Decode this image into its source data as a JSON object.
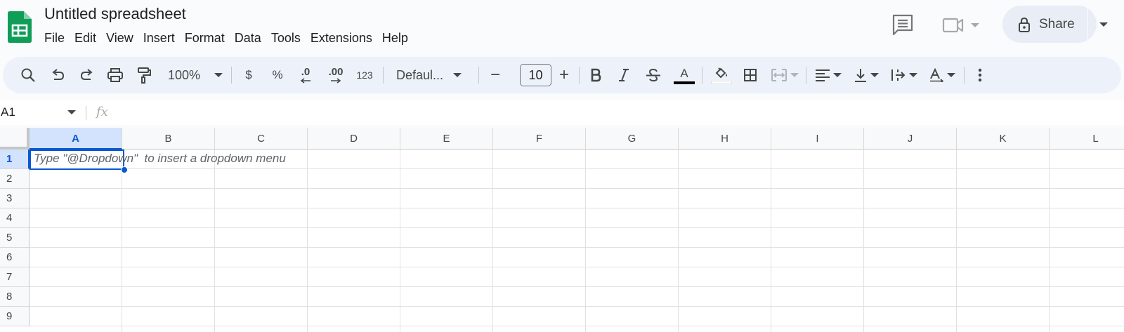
{
  "app": {
    "title": "Untitled spreadsheet",
    "brand_color": "#0f9d58"
  },
  "menubar": {
    "items": [
      "File",
      "Edit",
      "View",
      "Insert",
      "Format",
      "Data",
      "Tools",
      "Extensions",
      "Help"
    ]
  },
  "header_actions": {
    "comment_icon": "comment-icon",
    "meet_icon": "video-camera-icon",
    "share_label": "Share",
    "share_icon": "lock-icon"
  },
  "toolbar": {
    "zoom": "100%",
    "currency_label": "$",
    "percent_label": "%",
    "decrease_decimal_label": ".0",
    "increase_decimal_label": ".00",
    "more_formats_label": "123",
    "font_family": "Defaul...",
    "font_size": "10",
    "decrease_size_label": "−",
    "increase_size_label": "+",
    "text_color": "#000000",
    "fill_color": "#ffffff"
  },
  "formula_bar": {
    "name_box": "A1",
    "fx_label": "fx",
    "formula": ""
  },
  "grid": {
    "columns": [
      "A",
      "B",
      "C",
      "D",
      "E",
      "F",
      "G",
      "H",
      "I",
      "J",
      "K",
      "L"
    ],
    "rows": [
      "1",
      "2",
      "3",
      "4",
      "5",
      "6",
      "7",
      "8",
      "9"
    ],
    "selected_column": "A",
    "selected_row": "1",
    "active_cell": "A1",
    "active_cell_hint": "Type \"@Dropdown\"  to insert a dropdown menu",
    "selection_color": "#0b57d0"
  }
}
